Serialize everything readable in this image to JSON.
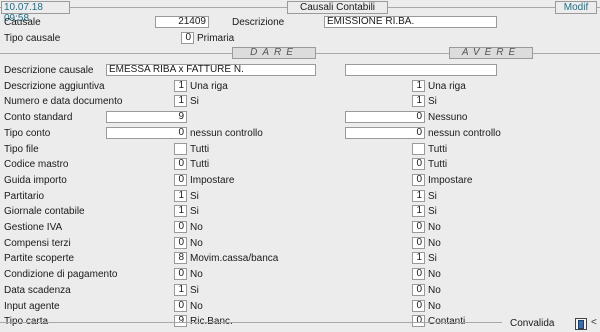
{
  "header": {
    "date_time": "10.07.18 09:58",
    "title": "Causali Contabili",
    "mode": "Modif"
  },
  "top": {
    "causale_label": "Causale",
    "causale_value": "21409",
    "descrizione_label": "Descrizione",
    "descrizione_value": "EMISSIONE RI.BA.",
    "tipo_causale_label": "Tipo causale",
    "tipo_causale_value": "0",
    "tipo_causale_text": "Primaria"
  },
  "sections": {
    "dare": "DARE",
    "avere": "AVERE"
  },
  "rows": [
    {
      "label": "Descrizione causale",
      "dare_value": "EMESSA RIBA x FATTURE N.",
      "dare_text": "",
      "avere_value": "",
      "avere_text": ""
    },
    {
      "label": "Descrizione aggiuntiva",
      "dare_value": "1",
      "dare_text": "Una riga",
      "avere_value": "1",
      "avere_text": "Una riga"
    },
    {
      "label": "Numero e data documento",
      "dare_value": "1",
      "dare_text": "Si",
      "avere_value": "1",
      "avere_text": "Si"
    },
    {
      "label": "Conto standard",
      "dare_value": "9",
      "dare_text": "",
      "avere_value": "0",
      "avere_text": "Nessuno"
    },
    {
      "label": "Tipo conto",
      "dare_value": "0",
      "dare_text": "nessun controllo",
      "avere_value": "0",
      "avere_text": "nessun controllo"
    },
    {
      "label": "Tipo file",
      "dare_value": "",
      "dare_text": "Tutti",
      "avere_value": "",
      "avere_text": "Tutti"
    },
    {
      "label": "Codice mastro",
      "dare_value": "0",
      "dare_text": "Tutti",
      "avere_value": "0",
      "avere_text": "Tutti"
    },
    {
      "label": "Guida importo",
      "dare_value": "0",
      "dare_text": "Impostare",
      "avere_value": "0",
      "avere_text": "Impostare"
    },
    {
      "label": "Partitario",
      "dare_value": "1",
      "dare_text": "Si",
      "avere_value": "1",
      "avere_text": "Si"
    },
    {
      "label": "Giornale contabile",
      "dare_value": "1",
      "dare_text": "Si",
      "avere_value": "1",
      "avere_text": "Si"
    },
    {
      "label": "Gestione IVA",
      "dare_value": "0",
      "dare_text": "No",
      "avere_value": "0",
      "avere_text": "No"
    },
    {
      "label": "Compensi terzi",
      "dare_value": "0",
      "dare_text": "No",
      "avere_value": "0",
      "avere_text": "No"
    },
    {
      "label": "Partite scoperte",
      "dare_value": "8",
      "dare_text": "Movim.cassa/banca",
      "avere_value": "1",
      "avere_text": "Si"
    },
    {
      "label": "Condizione di pagamento",
      "dare_value": "0",
      "dare_text": "No",
      "avere_value": "0",
      "avere_text": "No"
    },
    {
      "label": "Data scadenza",
      "dare_value": "1",
      "dare_text": "Si",
      "avere_value": "0",
      "avere_text": "No"
    },
    {
      "label": "Input agente",
      "dare_value": "0",
      "dare_text": "No",
      "avere_value": "0",
      "avere_text": "No"
    },
    {
      "label": "Tipo carta",
      "dare_value": "9",
      "dare_text": "Ric.Banc.",
      "avere_value": "0",
      "avere_text": "Contanti"
    }
  ],
  "footer": {
    "convalida_label": "Convalida",
    "arrow": "<",
    "icon": "book-icon"
  }
}
